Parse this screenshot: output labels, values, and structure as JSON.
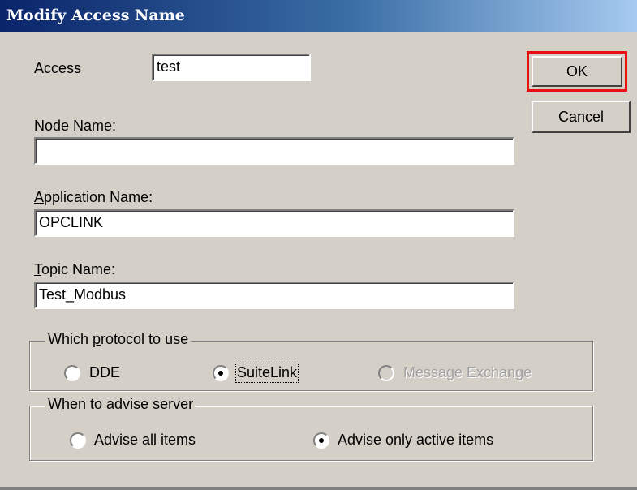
{
  "window": {
    "title": "Modify Access Name"
  },
  "access": {
    "label": "Access",
    "value": "test"
  },
  "node_name": {
    "label": "Node Name:",
    "value": ""
  },
  "application_name": {
    "label_mnemonic": "A",
    "label_rest": "pplication Name:",
    "value": "OPCLINK"
  },
  "topic_name": {
    "label_mnemonic": "T",
    "label_rest": "opic Name:",
    "value": "Test_Modbus"
  },
  "buttons": {
    "ok": "OK",
    "cancel": "Cancel"
  },
  "protocol": {
    "legend_pre": "Which ",
    "legend_mnemonic": "p",
    "legend_post": "rotocol to use",
    "options": [
      "DDE",
      "SuiteLink",
      "Message Exchange"
    ],
    "selected": "SuiteLink"
  },
  "advise": {
    "legend_mnemonic": "W",
    "legend_post": "hen to advise server",
    "options": [
      "Advise all items",
      "Advise only active items"
    ],
    "selected": "Advise only active items"
  },
  "colors": {
    "highlight": "#e81010",
    "dialog_bg": "#d4d0c8",
    "title_start": "#0a246a",
    "title_end": "#a6caf0"
  }
}
